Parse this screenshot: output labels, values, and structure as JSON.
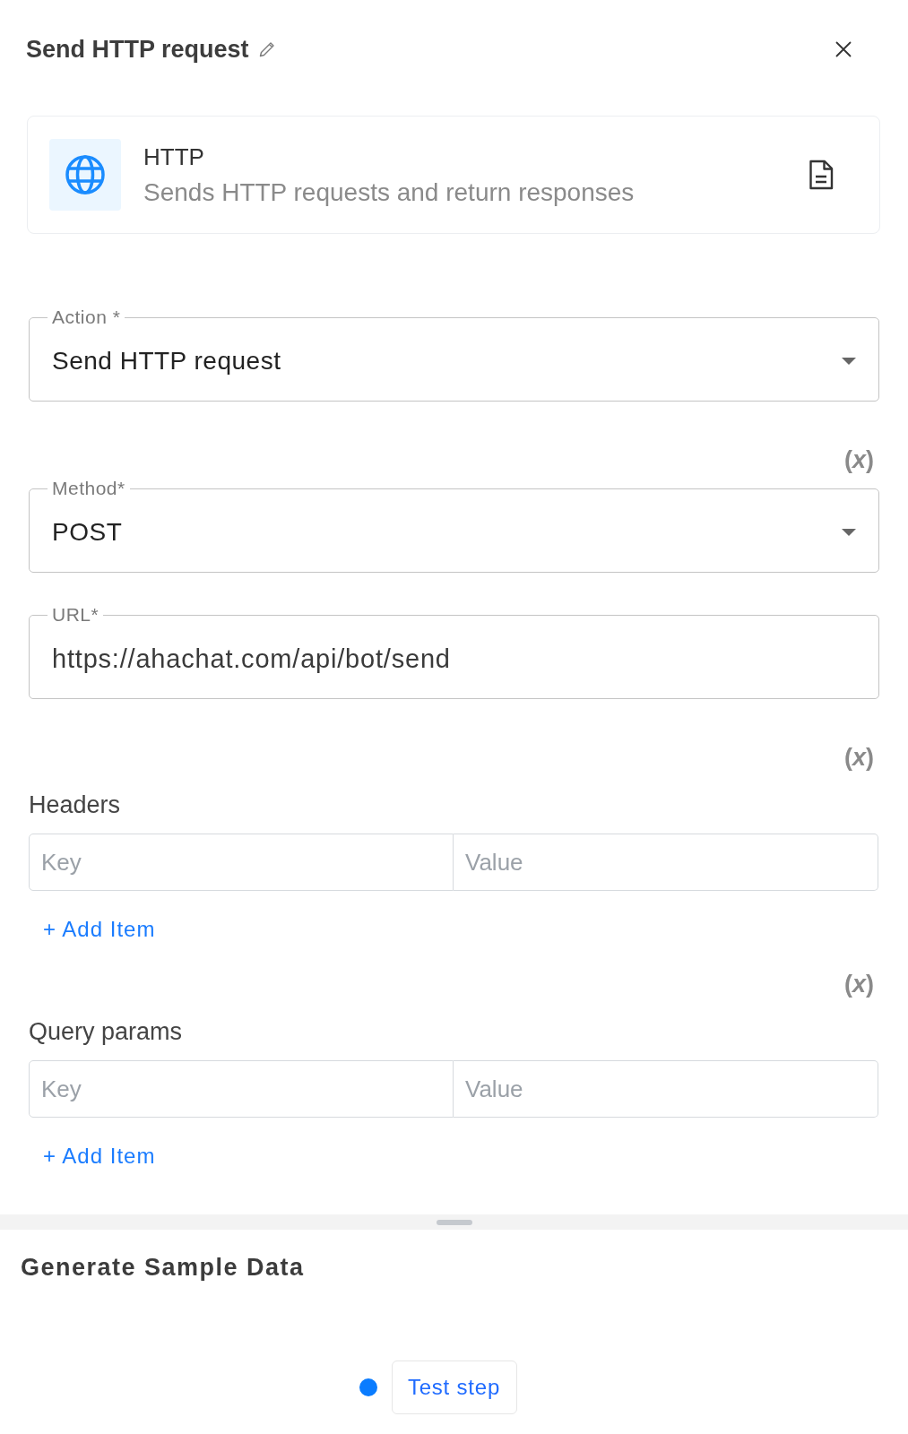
{
  "panel": {
    "title": "Send HTTP request"
  },
  "app_card": {
    "name": "HTTP",
    "description": "Sends HTTP requests and return responses"
  },
  "form": [
    {
      "kind": "select",
      "label": "Action *",
      "value": "Send HTTP request"
    },
    {
      "kind": "select",
      "variable_toggle": "(*x*)",
      "label": "Method*",
      "value": "POST"
    },
    {
      "kind": "text",
      "label": "URL*",
      "value": "https://ahachat.com/api/bot/send"
    },
    {
      "kind": "key_value",
      "variable_toggle": "(*x*)",
      "label": "Headers",
      "key_placeholder": "Key",
      "value_placeholder": "Value",
      "add_button": "+ Add Item"
    },
    {
      "kind": "key_value",
      "variable_toggle": "(*x*)",
      "label": "Query params",
      "key_placeholder": "Key",
      "value_placeholder": "Value",
      "add_button": "+ Add Item"
    }
  ],
  "sample_data": {
    "title": "Generate Sample Data",
    "button": "Test step"
  }
}
